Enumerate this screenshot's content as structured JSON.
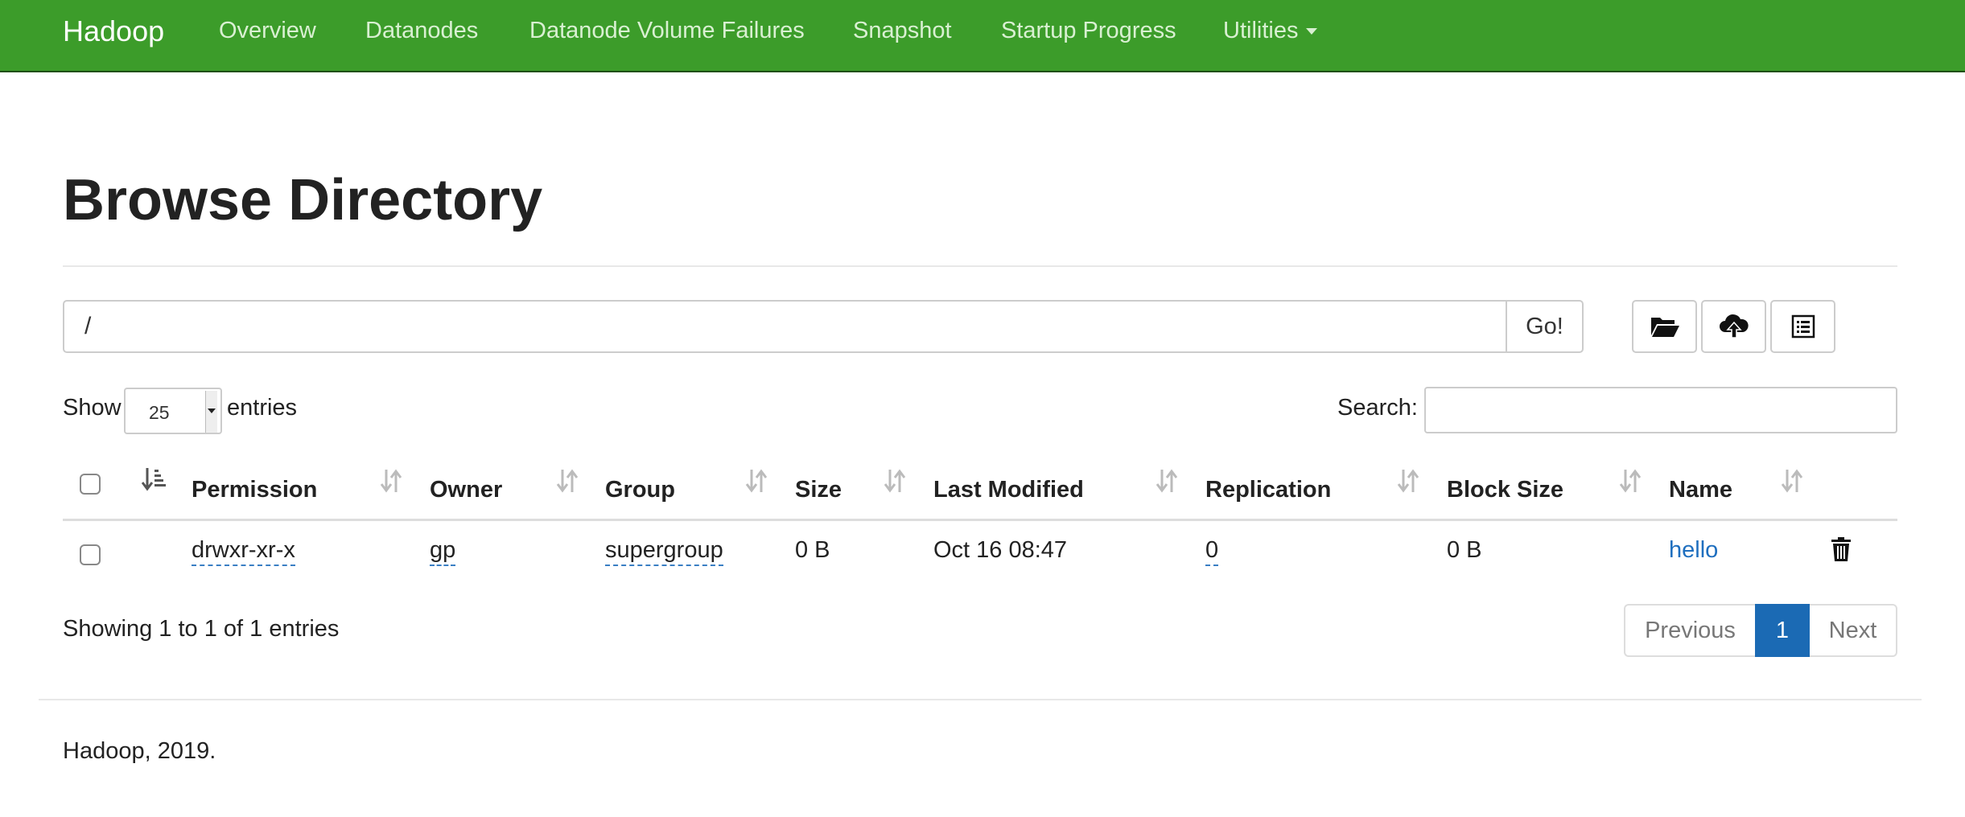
{
  "navbar": {
    "brand": "Hadoop",
    "links": [
      "Overview",
      "Datanodes",
      "Datanode Volume Failures",
      "Snapshot",
      "Startup Progress",
      "Utilities"
    ],
    "bg_color": "#3c9c2a"
  },
  "page": {
    "title": "Browse Directory"
  },
  "path_bar": {
    "value": "/",
    "go_label": "Go!"
  },
  "tools": {
    "icons": [
      "folder-open-icon",
      "cloud-upload-icon",
      "list-alt-icon"
    ]
  },
  "length_control": {
    "show_label": "Show",
    "value": "25",
    "entries_label": "entries"
  },
  "search": {
    "label": "Search:",
    "value": ""
  },
  "table": {
    "columns": [
      "Permission",
      "Owner",
      "Group",
      "Size",
      "Last Modified",
      "Replication",
      "Block Size",
      "Name"
    ],
    "sorted_column": "checkbox",
    "rows": [
      {
        "permission": "drwxr-xr-x",
        "owner": "gp",
        "group": "supergroup",
        "size": "0 B",
        "last_modified": "Oct 16 08:47",
        "replication": "0",
        "block_size": "0 B",
        "name": "hello"
      }
    ]
  },
  "info": "Showing 1 to 1 of 1 entries",
  "pagination": {
    "previous": "Previous",
    "current": "1",
    "next": "Next",
    "accent": "#1b6ab4"
  },
  "footer": {
    "text": "Hadoop, 2019."
  }
}
